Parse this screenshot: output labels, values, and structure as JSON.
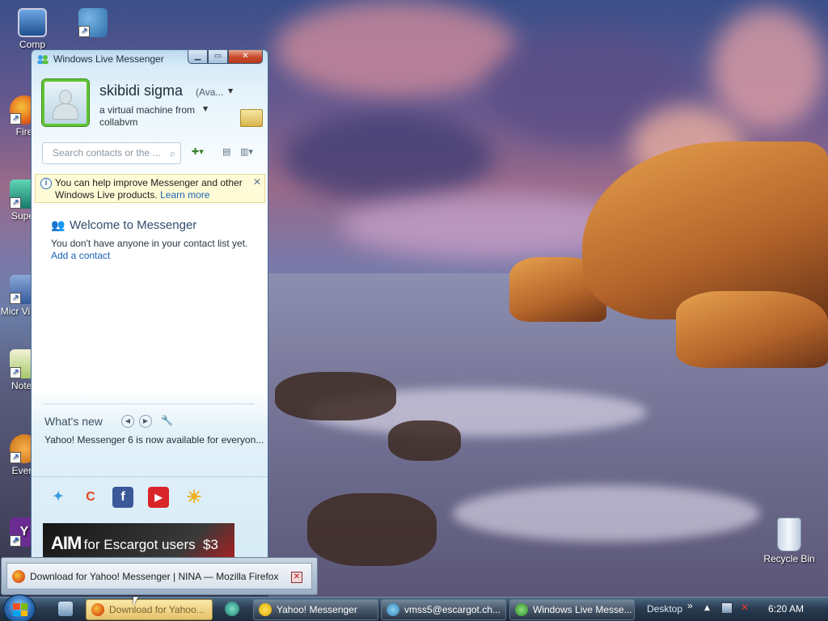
{
  "desktop": {
    "icons": [
      {
        "label": "Comp",
        "icon": "computer-icon"
      },
      {
        "label": "",
        "icon": "network-users-icon"
      },
      {
        "label": "Fire",
        "icon": "firefox-icon"
      },
      {
        "label": "Super",
        "icon": "app-icon"
      },
      {
        "label": "Micr Visual",
        "icon": "visual-studio-icon"
      },
      {
        "label": "Notep",
        "icon": "notepad-icon"
      },
      {
        "label": "Every",
        "icon": "everything-icon"
      },
      {
        "label": "",
        "icon": "yahoo-icon"
      },
      {
        "label": "Recycle Bin",
        "icon": "recycle-bin-icon"
      }
    ]
  },
  "messenger": {
    "title": "Windows Live Messenger",
    "username": "skibidi sigma",
    "status": "(Ava...",
    "personal_message": "a virtual machine from collabvm",
    "search_placeholder": "Search contacts or the ...",
    "info_text": "You can help improve Messenger and other Windows Live products.",
    "info_link": "Learn more",
    "welcome_title": "Welcome to Messenger",
    "no_contacts_text": "You don't have anyone in your contact list yet.",
    "add_contact_link": "Add a contact",
    "whats_new_title": "What's new",
    "whats_new_text": "Yahoo! Messenger 6 is now available for everyon...",
    "ad_brand": "AIM",
    "ad_text": "for Escargot users",
    "ad_partial": "$3"
  },
  "popup": {
    "text": "Download for Yahoo! Messenger | NINA — Mozilla Firefox"
  },
  "taskbar": {
    "buttons": [
      {
        "label": "Download for Yahoo...",
        "active": true
      },
      {
        "label": "Yahoo! Messenger",
        "active": false
      },
      {
        "label": "vmss5@escargot.ch...",
        "active": false
      },
      {
        "label": "Windows Live Messe...",
        "active": false
      }
    ],
    "toolbar_label": "Desktop",
    "toolbar_chevron": "»",
    "clock": "6:20 AM"
  },
  "colors": {
    "accent": "#4a6f96",
    "status_online": "#61c431",
    "link": "#1a63b8"
  }
}
